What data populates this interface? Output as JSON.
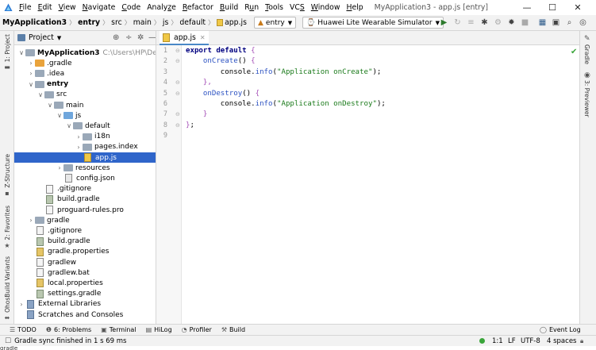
{
  "menu": {
    "items": [
      {
        "pre": "",
        "u": "F",
        "post": "ile"
      },
      {
        "pre": "",
        "u": "E",
        "post": "dit"
      },
      {
        "pre": "",
        "u": "V",
        "post": "iew"
      },
      {
        "pre": "",
        "u": "N",
        "post": "avigate"
      },
      {
        "pre": "",
        "u": "C",
        "post": "ode"
      },
      {
        "pre": "Analy",
        "u": "z",
        "post": "e"
      },
      {
        "pre": "",
        "u": "R",
        "post": "efactor"
      },
      {
        "pre": "",
        "u": "B",
        "post": "uild"
      },
      {
        "pre": "R",
        "u": "u",
        "post": "n"
      },
      {
        "pre": "",
        "u": "T",
        "post": "ools"
      },
      {
        "pre": "VC",
        "u": "S",
        "post": ""
      },
      {
        "pre": "",
        "u": "W",
        "post": "indow"
      },
      {
        "pre": "",
        "u": "H",
        "post": "elp"
      }
    ],
    "window_title": "MyApplication3 - app.js [entry]",
    "minimize": "—",
    "maximize": "☐",
    "close": "✕"
  },
  "nav": {
    "crumbs": [
      "MyApplication3",
      "entry",
      "src",
      "main",
      "js",
      "default",
      "app.js"
    ],
    "run_config": "entry",
    "device": "Huawei Lite Wearable Simulator"
  },
  "left_tabs": {
    "project": "1: Project",
    "structure": "Z-Structure",
    "favorites": "2: Favorites",
    "build_variants": "OhosBuild Variants"
  },
  "right_tabs": {
    "gradle": "Gradle",
    "previewer": "3: Previewer"
  },
  "project_panel": {
    "title": "Project",
    "root_path": "C:\\Users\\HP\\DevEco"
  },
  "tree": [
    {
      "label": "MyApplication3",
      "arrow": "open",
      "icon": "folder",
      "depth": 0,
      "bold": true
    },
    {
      "label": ".gradle",
      "arrow": "closed",
      "icon": "folder-orange",
      "depth": 1
    },
    {
      "label": ".idea",
      "arrow": "closed",
      "icon": "folder",
      "depth": 1
    },
    {
      "label": "entry",
      "arrow": "open",
      "icon": "folder",
      "depth": 1,
      "bold": true
    },
    {
      "label": "src",
      "arrow": "open",
      "icon": "folder",
      "depth": 2
    },
    {
      "label": "main",
      "arrow": "open",
      "icon": "folder",
      "depth": 3
    },
    {
      "label": "js",
      "arrow": "open",
      "icon": "folder-blue",
      "depth": 4
    },
    {
      "label": "default",
      "arrow": "open",
      "icon": "folder",
      "depth": 5
    },
    {
      "label": "i18n",
      "arrow": "closed",
      "icon": "folder",
      "depth": 6
    },
    {
      "label": "pages.index",
      "arrow": "closed",
      "icon": "folder",
      "depth": 6
    },
    {
      "label": "app.js",
      "arrow": "",
      "icon": "file-js",
      "depth": 6,
      "selected": true
    },
    {
      "label": "resources",
      "arrow": "closed",
      "icon": "folder",
      "depth": 4
    },
    {
      "label": "config.json",
      "arrow": "",
      "icon": "file-json",
      "depth": 4
    },
    {
      "label": ".gitignore",
      "arrow": "",
      "icon": "file",
      "depth": 2
    },
    {
      "label": "build.gradle",
      "arrow": "",
      "icon": "file-gradle",
      "depth": 2
    },
    {
      "label": "proguard-rules.pro",
      "arrow": "",
      "icon": "file",
      "depth": 2
    },
    {
      "label": "gradle",
      "arrow": "closed",
      "icon": "folder",
      "depth": 1
    },
    {
      "label": ".gitignore",
      "arrow": "",
      "icon": "file",
      "depth": 1
    },
    {
      "label": "build.gradle",
      "arrow": "",
      "icon": "file-gradle",
      "depth": 1
    },
    {
      "label": "gradle.properties",
      "arrow": "",
      "icon": "file-prop",
      "depth": 1
    },
    {
      "label": "gradlew",
      "arrow": "",
      "icon": "file",
      "depth": 1
    },
    {
      "label": "gradlew.bat",
      "arrow": "",
      "icon": "file",
      "depth": 1
    },
    {
      "label": "local.properties",
      "arrow": "",
      "icon": "file-prop",
      "depth": 1
    },
    {
      "label": "settings.gradle",
      "arrow": "",
      "icon": "file-gradle",
      "depth": 1
    },
    {
      "label": "External Libraries",
      "arrow": "closed",
      "icon": "file-lib",
      "depth": 0
    },
    {
      "label": "Scratches and Consoles",
      "arrow": "",
      "icon": "file-lib",
      "depth": 0
    }
  ],
  "editor": {
    "tab_label": "app.js",
    "line_numbers": [
      "1",
      "2",
      "3",
      "4",
      "5",
      "6",
      "7",
      "8",
      "9"
    ],
    "code": [
      [
        {
          "t": "export default ",
          "c": "kw"
        },
        {
          "t": "{",
          "c": "br"
        }
      ],
      [
        {
          "t": "    "
        },
        {
          "t": "onCreate",
          "c": "fn"
        },
        {
          "t": "() "
        },
        {
          "t": "{",
          "c": "br"
        }
      ],
      [
        {
          "t": "        console."
        },
        {
          "t": "info",
          "c": "fn"
        },
        {
          "t": "("
        },
        {
          "t": "\"Application onCreate\"",
          "c": "str"
        },
        {
          "t": ");"
        }
      ],
      [
        {
          "t": "    "
        },
        {
          "t": "},",
          "c": "br"
        }
      ],
      [
        {
          "t": "    "
        },
        {
          "t": "onDestroy",
          "c": "fn"
        },
        {
          "t": "() "
        },
        {
          "t": "{",
          "c": "br"
        }
      ],
      [
        {
          "t": "        console."
        },
        {
          "t": "info",
          "c": "fn"
        },
        {
          "t": "("
        },
        {
          "t": "\"Application onDestroy\"",
          "c": "str"
        },
        {
          "t": ");"
        }
      ],
      [
        {
          "t": "    "
        },
        {
          "t": "}",
          "c": "br"
        }
      ],
      [
        {
          "t": "}",
          "c": "br"
        },
        {
          "t": ";"
        }
      ],
      []
    ]
  },
  "bottom_tools": {
    "todo": "TODO",
    "problems": "6: Problems",
    "terminal": "Terminal",
    "hilog": "HiLog",
    "profiler": "Profiler",
    "build": "Build",
    "event_log": "Event Log"
  },
  "status": {
    "message": "Gradle sync finished in 1 s 69 ms",
    "position": "1:1",
    "line_sep": "LF",
    "encoding": "UTF-8",
    "indent": "4 spaces",
    "ok_color": "#3aa53a"
  },
  "below_text": "gradle"
}
